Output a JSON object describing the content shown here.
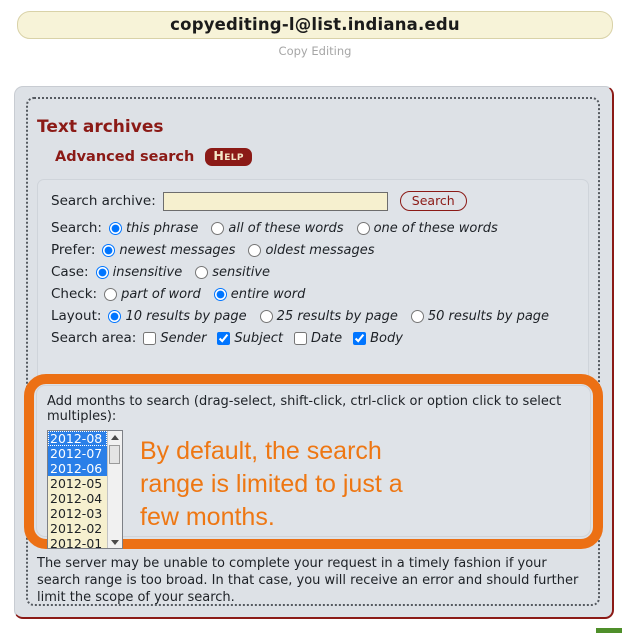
{
  "banner": {
    "list_address": "copyediting-l@list.indiana.edu",
    "list_subtitle": "Copy Editing"
  },
  "archive": {
    "section_title": "Text archives",
    "advanced_search_label": "Advanced search",
    "help_badge": "Help"
  },
  "search_form": {
    "search_archive_label": "Search archive:",
    "search_input_value": "",
    "search_input_placeholder": "",
    "search_button": "Search",
    "rows": [
      {
        "label": "Search:",
        "type": "radio",
        "options": [
          {
            "text": "this phrase",
            "checked": true
          },
          {
            "text": "all of these words",
            "checked": false
          },
          {
            "text": "one of these words",
            "checked": false
          }
        ]
      },
      {
        "label": "Prefer:",
        "type": "radio",
        "options": [
          {
            "text": "newest messages",
            "checked": true
          },
          {
            "text": "oldest messages",
            "checked": false
          }
        ]
      },
      {
        "label": "Case:",
        "type": "radio",
        "options": [
          {
            "text": "insensitive",
            "checked": true
          },
          {
            "text": "sensitive",
            "checked": false
          }
        ]
      },
      {
        "label": "Check:",
        "type": "radio",
        "options": [
          {
            "text": "part of word",
            "checked": false
          },
          {
            "text": "entire word",
            "checked": true
          }
        ]
      },
      {
        "label": "Layout:",
        "type": "radio",
        "options": [
          {
            "text": "10 results by page",
            "checked": true
          },
          {
            "text": "25 results by page",
            "checked": false
          },
          {
            "text": "50 results by page",
            "checked": false
          }
        ]
      },
      {
        "label": "Search area:",
        "type": "checkbox",
        "options": [
          {
            "text": "Sender",
            "checked": false
          },
          {
            "text": "Subject",
            "checked": true
          },
          {
            "text": "Date",
            "checked": false
          },
          {
            "text": "Body",
            "checked": true
          }
        ]
      }
    ]
  },
  "months": {
    "label": "Add months to search (drag-select, shift-click, ctrl-click or option click to select multiples):",
    "items": [
      {
        "value": "2012-08",
        "selected": true,
        "focused": true
      },
      {
        "value": "2012-07",
        "selected": true,
        "focused": false
      },
      {
        "value": "2012-06",
        "selected": true,
        "focused": false
      },
      {
        "value": "2012-05",
        "selected": false,
        "focused": false
      },
      {
        "value": "2012-04",
        "selected": false,
        "focused": false
      },
      {
        "value": "2012-03",
        "selected": false,
        "focused": false
      },
      {
        "value": "2012-02",
        "selected": false,
        "focused": false
      },
      {
        "value": "2012-01",
        "selected": false,
        "focused": false
      }
    ]
  },
  "annotation": {
    "line1": "By default, the search",
    "line2": "range is limited to just a",
    "line3": "few months.",
    "color": "#ee7713"
  },
  "warning": {
    "text": "The server may be unable to complete your request in a timely fashion if your search range is too broad. In that case, you will receive an error and should further limit the scope of your search."
  },
  "colors": {
    "accent_red": "#8b1a16",
    "highlight_orange": "#ec7014",
    "selection_blue": "#2a7fe8",
    "field_cream": "#f6f0cf"
  }
}
